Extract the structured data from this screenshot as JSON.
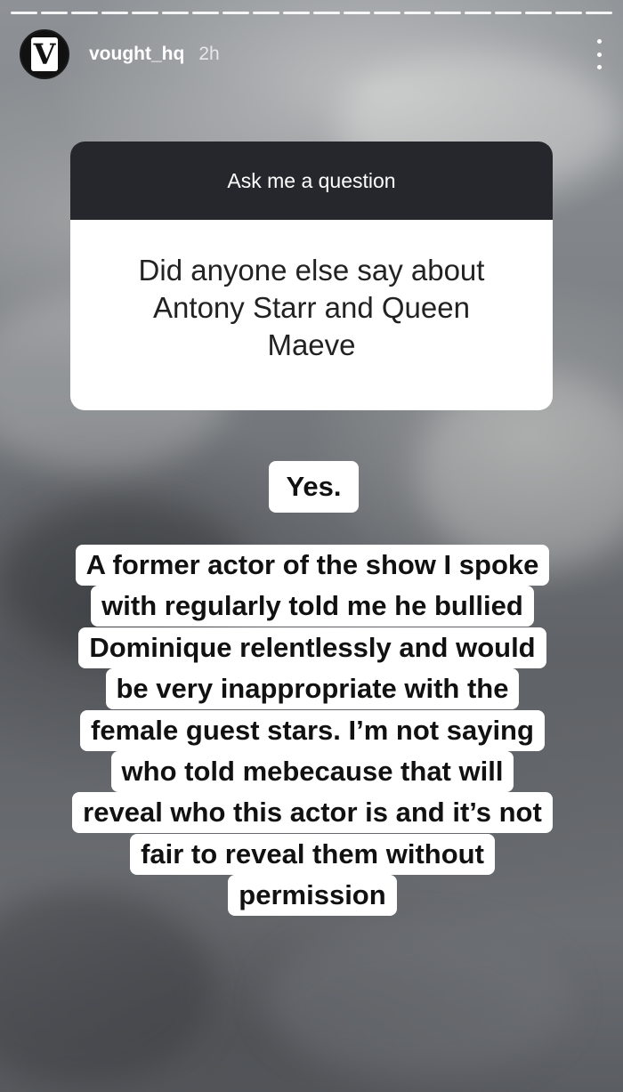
{
  "story": {
    "progress_segments": 20
  },
  "header": {
    "username": "vought_hq",
    "time": "2h",
    "avatar_letter": "V"
  },
  "question_sticker": {
    "title": "Ask me a question",
    "question": "Did anyone else say about Antony Starr and Queen Maeve"
  },
  "answer": {
    "short": "Yes.",
    "lines": [
      "A former actor of the show I spoke",
      "with regularly told me he bullied",
      "Dominique relentlessly and would",
      "be very inappropriate with the",
      "female guest stars. I’m not saying",
      "who told mebecause that will",
      "reveal who this actor is and it’s not",
      "fair to reveal them without",
      "permission"
    ]
  }
}
